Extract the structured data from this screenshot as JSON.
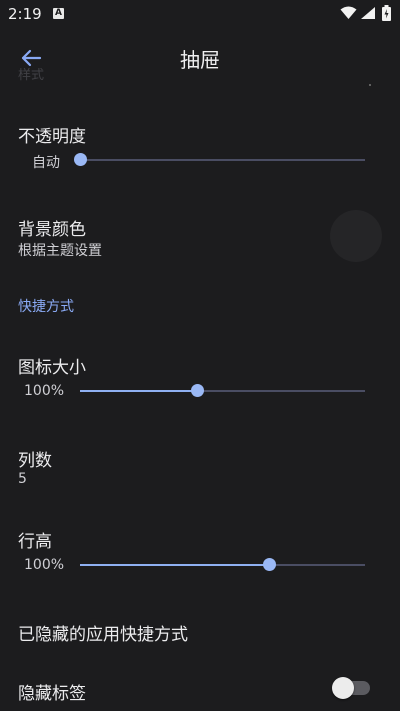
{
  "status_bar": {
    "time": "2:19",
    "notification_icon": "A"
  },
  "header": {
    "title": "抽屉",
    "back_icon": "arrow-left-icon"
  },
  "ghost_label": "样式",
  "settings": {
    "opacity": {
      "label": "不透明度",
      "value_text": "自动",
      "level": 0
    },
    "background_color": {
      "label": "背景颜色",
      "value": "根据主题设置"
    },
    "section_shortcuts": "快捷方式",
    "icon_size": {
      "label": "图标大小",
      "value_text": "100%",
      "level": 0.41
    },
    "columns": {
      "label": "列数",
      "value": "5"
    },
    "row_height": {
      "label": "行高",
      "value_text": "100%",
      "level": 0.67
    },
    "hidden_apps": {
      "label": "已隐藏的应用快捷方式"
    },
    "hide_labels": {
      "label": "隐藏标签",
      "enabled": false
    }
  },
  "colors": {
    "accent": "#8aaaf5",
    "background": "#1c1c1e"
  }
}
